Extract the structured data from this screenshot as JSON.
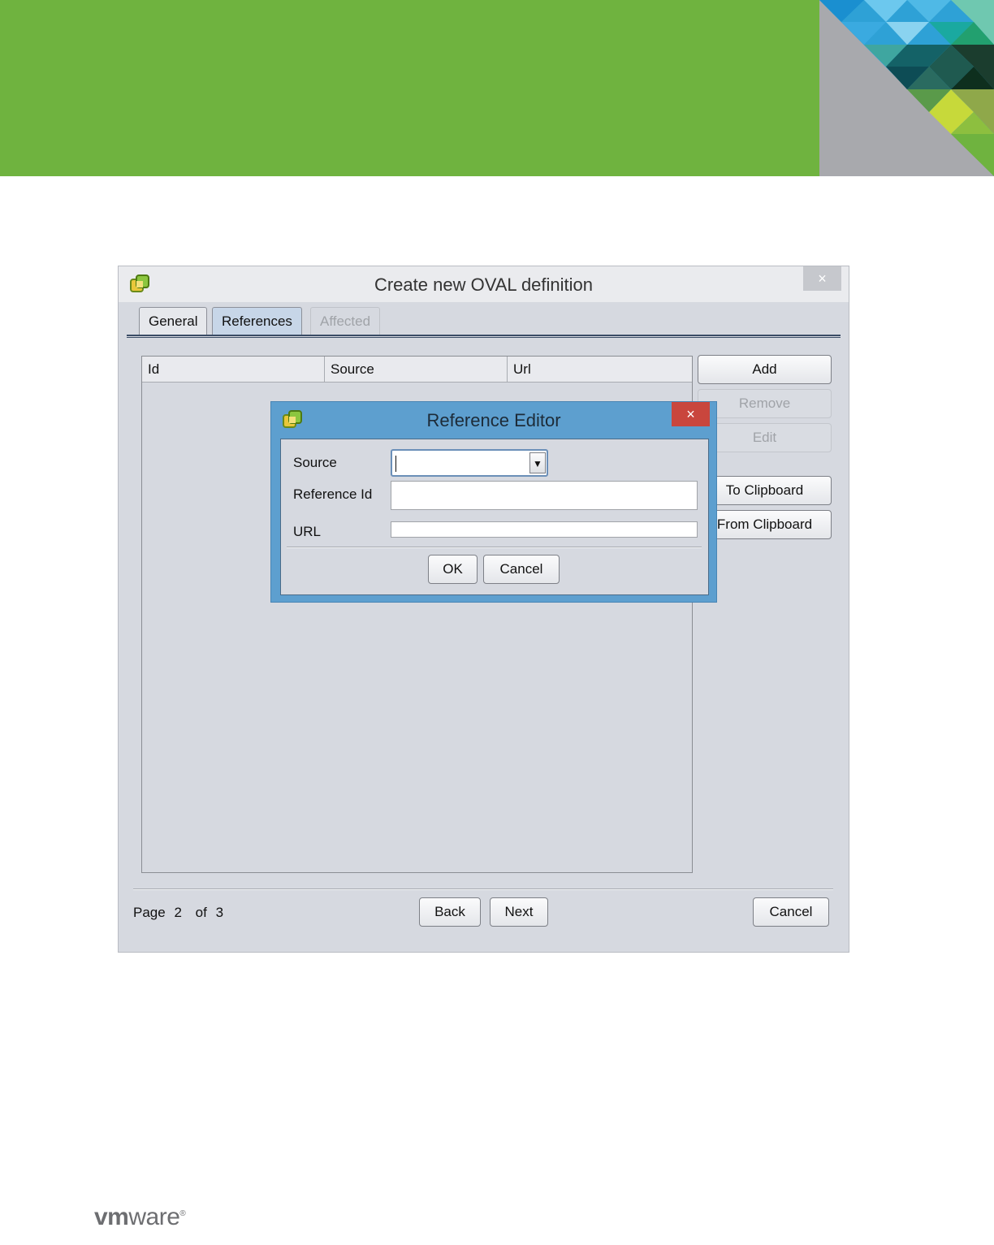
{
  "dialog": {
    "title": "Create new OVAL definition",
    "close_label": "×",
    "tabs": [
      {
        "label": "General",
        "state": "normal"
      },
      {
        "label": "References",
        "state": "active"
      },
      {
        "label": "Affected",
        "state": "disabled"
      }
    ],
    "table": {
      "columns": [
        "Id",
        "Source",
        "Url"
      ]
    },
    "side_buttons": {
      "add": "Add",
      "remove": "Remove",
      "edit": "Edit",
      "to_clipboard": "To Clipboard",
      "from_clipboard": "From Clipboard"
    },
    "footer": {
      "page_word": "Page",
      "page_current": "2",
      "of_word": "of",
      "page_total": "3",
      "back": "Back",
      "next": "Next",
      "cancel": "Cancel"
    }
  },
  "editor": {
    "title": "Reference Editor",
    "close_label": "×",
    "fields": {
      "source_label": "Source",
      "source_value": "",
      "reference_id_label": "Reference Id",
      "reference_id_value": "",
      "url_label": "URL",
      "url_value": ""
    },
    "ok": "OK",
    "cancel": "Cancel"
  },
  "brand": {
    "logo_bold": "vm",
    "logo_light": "ware",
    "logo_mark": "®",
    "banner_color": "#6fb33f"
  },
  "icons": {
    "app": "vmware-app-icon",
    "dropdown": "triangle-down-icon",
    "close": "close-icon"
  }
}
